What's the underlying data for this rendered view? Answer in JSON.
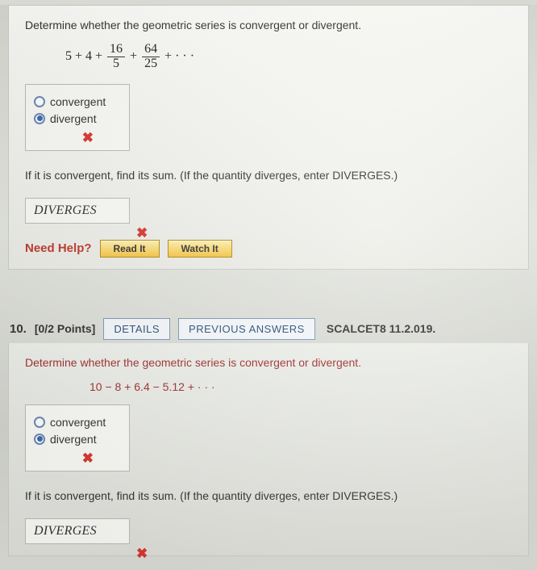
{
  "q1": {
    "prompt": "Determine whether the geometric series is convergent or divergent.",
    "series": {
      "t1": "5 + 4 +",
      "n1": "16",
      "d1": "5",
      "plus": "+",
      "n2": "64",
      "d2": "25",
      "tail": "+ · · ·"
    },
    "options": {
      "a": "convergent",
      "b": "divergent"
    },
    "mark": "✖",
    "followup": "If it is convergent, find its sum. (If the quantity diverges, enter DIVERGES.)",
    "answer": "DIVERGES",
    "help_label": "Need Help?",
    "read": "Read It",
    "watch": "Watch It"
  },
  "header": {
    "num": "10.",
    "points": "[0/2 Points]",
    "details": "DETAILS",
    "prev": "PREVIOUS ANSWERS",
    "book": "SCALCET8 11.2.019."
  },
  "q2": {
    "prompt": "Determine whether the geometric series is convergent or divergent.",
    "series": "10 − 8 + 6.4 − 5.12 + · · ·",
    "options": {
      "a": "convergent",
      "b": "divergent"
    },
    "mark": "✖",
    "followup": "If it is convergent, find its sum. (If the quantity diverges, enter DIVERGES.)",
    "answer": "DIVERGES"
  }
}
